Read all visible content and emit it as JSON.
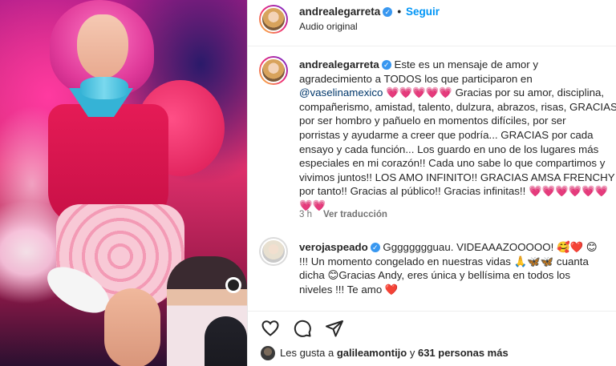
{
  "post": {
    "username": "andrealegarreta",
    "follow_label": "Seguir",
    "dot": "•",
    "audio": "Audio original"
  },
  "caption": {
    "username": "andrealegarreta",
    "line1": " Este es un mensaje de amor y",
    "line2": "agradecimiento a TODOS los que participaron en",
    "mention": "@vaselinamexico",
    "line3_rest": " 💗💗💗💗💗 Gracias por su amor, disciplina,",
    "line4": "compañerismo, amistad, talento, dulzura, abrazos, risas, GRACIAS",
    "line5": "por ser hombro y pañuelo en momentos difíciles, por ser",
    "line6": "porristas y ayudarme a creer que podría... GRACIAS por cada",
    "line7": "ensayo y cada función... Los guardo en uno de los lugares más",
    "line8": "especiales en mi corazón!! Cada uno sabe lo que compartimos y",
    "line9": "vivimos juntos!! LOS AMO INFINITO!! GRACIAS AMSA FRENCHY",
    "line10": "por tanto!! Gracias al público!! Gracias infinitas!! 💗💗💗💗💗💗💗💗",
    "time": "3 h",
    "translate": "Ver traducción"
  },
  "comment": {
    "username": "verojaspeado",
    "line1": " Gggggggguau. VIDEAAAZOOOOO! 🥰❤️ 😊",
    "line2": "!!! Un momento congelado en nuestras vidas 🙏🦋🦋 cuanta",
    "line3": "dicha 😊Gracias Andy, eres única y bellísima en todos los",
    "line4": "niveles !!! Te amo ❤️"
  },
  "likes": {
    "prefix": "Les gusta a ",
    "user": "galileamontijo",
    "suffix": " y ",
    "count": "631 personas más"
  },
  "icons": [
    "heart-icon",
    "comment-icon",
    "share-icon",
    "verified-icon"
  ],
  "colors": {
    "link": "#0095f6",
    "verified": "#3897f0",
    "muted": "#737373"
  }
}
